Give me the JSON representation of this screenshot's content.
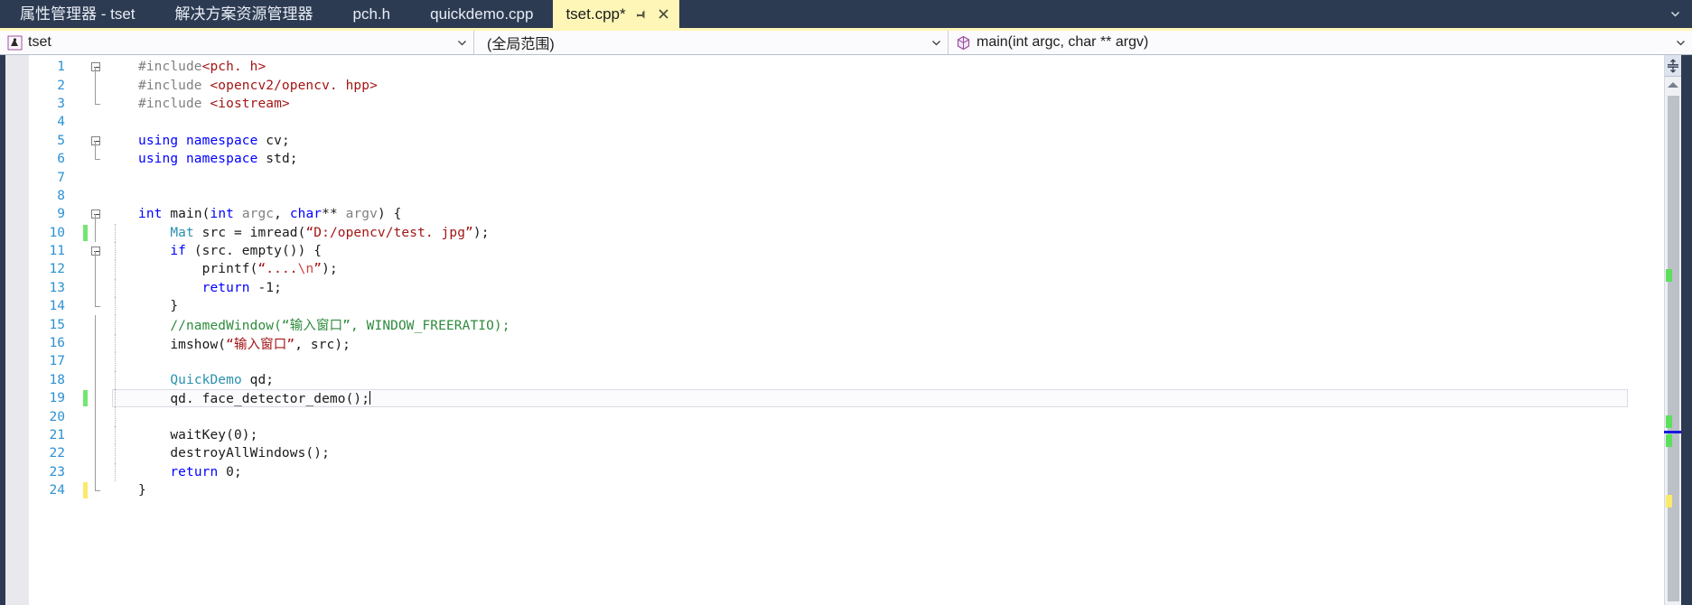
{
  "window": {
    "tabs": [
      {
        "label": "属性管理器 - tset",
        "active": false
      },
      {
        "label": "解决方案资源管理器",
        "active": false
      },
      {
        "label": "pch.h",
        "active": false
      },
      {
        "label": "quickdemo.cpp",
        "active": false
      },
      {
        "label": "tset.cpp*",
        "active": true
      }
    ],
    "tabstrip_overflow_icon": "chevron-down-icon",
    "active_tab_pin_icon": "pin-icon",
    "active_tab_close_icon": "close-icon",
    "active_tab_bg": "#fdf6b6",
    "tabstrip_bg": "#2d3b52"
  },
  "navbar": {
    "project_combo": {
      "icon": "project-icon",
      "value": "tset",
      "arrow": "chevron-down-icon"
    },
    "scope_combo": {
      "value": "(全局范围)",
      "arrow": "chevron-down-icon"
    },
    "member_combo": {
      "icon": "method-cube-icon",
      "value": "main(int argc, char ** argv)",
      "arrow": "chevron-down-icon"
    }
  },
  "editor": {
    "language": "cpp",
    "cursor_line": 19,
    "colors": {
      "keyword": "#0000ff",
      "type": "#2b91af",
      "string": "#a31515",
      "comment": "#2e8b3d",
      "preprocessor": "#808080",
      "parameter": "#808080",
      "line_number": "#2b91d4",
      "change_saved": "#73e673",
      "change_unsaved": "#fbe96b"
    },
    "lines": [
      {
        "n": 1,
        "fold": "start",
        "guide": "none",
        "change": "none",
        "tokens": [
          {
            "t": "#include",
            "c": "prep"
          },
          {
            "t": "<pch. h>",
            "c": "hdr"
          }
        ]
      },
      {
        "n": 2,
        "fold": "mid",
        "guide": "none",
        "change": "none",
        "tokens": [
          {
            "t": "#include ",
            "c": "prep"
          },
          {
            "t": "<opencv2/opencv. hpp>",
            "c": "hdr"
          }
        ]
      },
      {
        "n": 3,
        "fold": "end",
        "guide": "none",
        "change": "none",
        "tokens": [
          {
            "t": "#include ",
            "c": "prep"
          },
          {
            "t": "<iostream>",
            "c": "hdr"
          }
        ]
      },
      {
        "n": 4,
        "fold": "none",
        "guide": "none",
        "change": "none",
        "tokens": []
      },
      {
        "n": 5,
        "fold": "start",
        "guide": "none",
        "change": "none",
        "tokens": [
          {
            "t": "using namespace",
            "c": "kw"
          },
          {
            "t": " cv;",
            "c": "plain"
          }
        ]
      },
      {
        "n": 6,
        "fold": "end",
        "guide": "none",
        "change": "none",
        "tokens": [
          {
            "t": "using namespace",
            "c": "kw"
          },
          {
            "t": " std;",
            "c": "plain"
          }
        ]
      },
      {
        "n": 7,
        "fold": "none",
        "guide": "none",
        "change": "none",
        "tokens": []
      },
      {
        "n": 8,
        "fold": "none",
        "guide": "none",
        "change": "none",
        "tokens": []
      },
      {
        "n": 9,
        "fold": "start",
        "guide": "none",
        "change": "none",
        "tokens": [
          {
            "t": "int",
            "c": "kw"
          },
          {
            "t": " main(",
            "c": "plain"
          },
          {
            "t": "int",
            "c": "kw"
          },
          {
            "t": " argc",
            "c": "param"
          },
          {
            "t": ", ",
            "c": "plain"
          },
          {
            "t": "char",
            "c": "kw"
          },
          {
            "t": "** ",
            "c": "plain"
          },
          {
            "t": "argv",
            "c": "param"
          },
          {
            "t": ") {",
            "c": "plain"
          }
        ]
      },
      {
        "n": 10,
        "fold": "bar",
        "guide": "dot",
        "change": "green",
        "tokens": [
          {
            "t": "    ",
            "c": "plain"
          },
          {
            "t": "Mat",
            "c": "typ"
          },
          {
            "t": " src = imread(",
            "c": "plain"
          },
          {
            "t": "“D:/opencv/test. jpg”",
            "c": "str"
          },
          {
            "t": ");",
            "c": "plain"
          }
        ]
      },
      {
        "n": 11,
        "fold": "startinner",
        "guide": "dot",
        "change": "none",
        "tokens": [
          {
            "t": "    ",
            "c": "plain"
          },
          {
            "t": "if",
            "c": "kw"
          },
          {
            "t": " (src. empty()) {",
            "c": "plain"
          }
        ]
      },
      {
        "n": 12,
        "fold": "bar",
        "guide": "dot2",
        "change": "none",
        "tokens": [
          {
            "t": "        printf(",
            "c": "plain"
          },
          {
            "t": "“....",
            "c": "str"
          },
          {
            "t": "\\n",
            "c": "esc"
          },
          {
            "t": "”",
            "c": "str"
          },
          {
            "t": ");",
            "c": "plain"
          }
        ]
      },
      {
        "n": 13,
        "fold": "bar",
        "guide": "dot2",
        "change": "none",
        "tokens": [
          {
            "t": "        ",
            "c": "plain"
          },
          {
            "t": "return",
            "c": "kw"
          },
          {
            "t": " -1;",
            "c": "plain"
          }
        ]
      },
      {
        "n": 14,
        "fold": "endinner",
        "guide": "dot",
        "change": "none",
        "tokens": [
          {
            "t": "    }",
            "c": "plain"
          }
        ]
      },
      {
        "n": 15,
        "fold": "bar",
        "guide": "dot",
        "change": "none",
        "tokens": [
          {
            "t": "    //namedWindow(“输入窗口”, WINDOW_FREERATIO);",
            "c": "cmt"
          }
        ]
      },
      {
        "n": 16,
        "fold": "bar",
        "guide": "dot",
        "change": "none",
        "tokens": [
          {
            "t": "    imshow(",
            "c": "plain"
          },
          {
            "t": "“输入窗口”",
            "c": "str"
          },
          {
            "t": ", src);",
            "c": "plain"
          }
        ]
      },
      {
        "n": 17,
        "fold": "bar",
        "guide": "dot",
        "change": "none",
        "tokens": []
      },
      {
        "n": 18,
        "fold": "bar",
        "guide": "dot",
        "change": "none",
        "tokens": [
          {
            "t": "    ",
            "c": "plain"
          },
          {
            "t": "QuickDemo",
            "c": "typ"
          },
          {
            "t": " qd;",
            "c": "plain"
          }
        ]
      },
      {
        "n": 19,
        "fold": "bar",
        "guide": "dot",
        "change": "green",
        "current": true,
        "tokens": [
          {
            "t": "    qd. face_detector_demo();",
            "c": "plain"
          }
        ]
      },
      {
        "n": 20,
        "fold": "bar",
        "guide": "dot",
        "change": "none",
        "tokens": []
      },
      {
        "n": 21,
        "fold": "bar",
        "guide": "dot",
        "change": "none",
        "tokens": [
          {
            "t": "    waitKey(0);",
            "c": "plain"
          }
        ]
      },
      {
        "n": 22,
        "fold": "bar",
        "guide": "dot",
        "change": "none",
        "tokens": [
          {
            "t": "    destroyAllWindows();",
            "c": "plain"
          }
        ]
      },
      {
        "n": 23,
        "fold": "bar",
        "guide": "dot",
        "change": "none",
        "tokens": [
          {
            "t": "    ",
            "c": "plain"
          },
          {
            "t": "return",
            "c": "kw"
          },
          {
            "t": " 0;",
            "c": "plain"
          }
        ]
      },
      {
        "n": 24,
        "fold": "endouter",
        "guide": "none",
        "change": "yellow",
        "tokens": [
          {
            "t": "}",
            "c": "plain"
          }
        ]
      }
    ]
  },
  "scrollbar": {
    "split_view_icon": "split-view-icon",
    "up_arrow_icon": "arrow-up-icon",
    "markers": [
      {
        "kind": "green",
        "top_pct": 34.5
      },
      {
        "kind": "green",
        "top_pct": 63.0
      },
      {
        "kind": "caretline",
        "top_pct": 66.0
      },
      {
        "kind": "green",
        "top_pct": 66.8
      },
      {
        "kind": "yellow",
        "top_pct": 78.5
      }
    ]
  }
}
